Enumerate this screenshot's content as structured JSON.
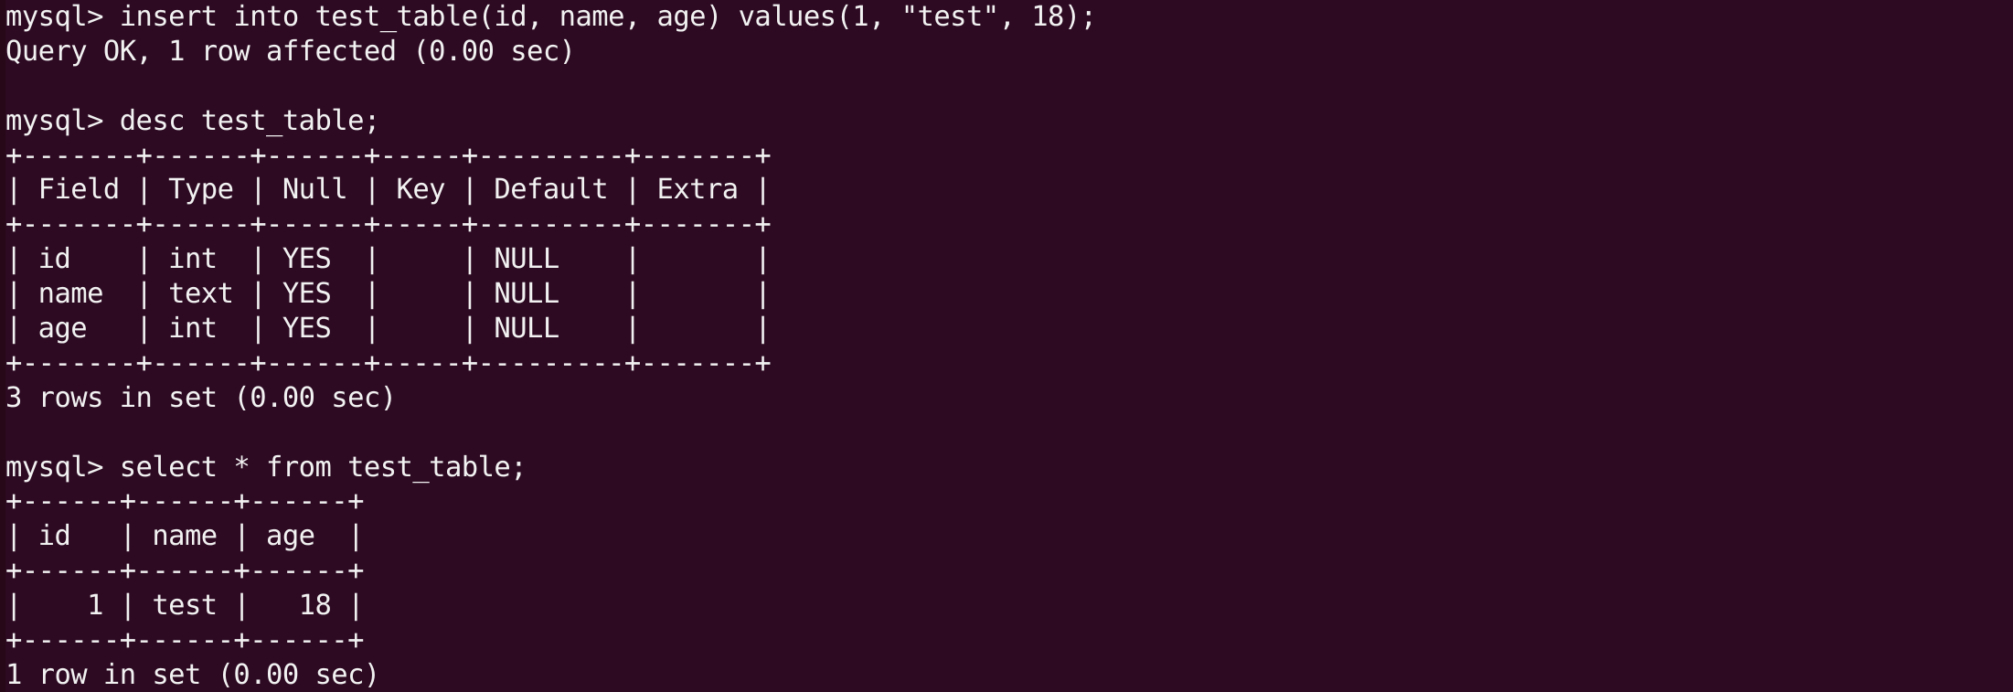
{
  "terminal": {
    "app": "mysql-client-terminal",
    "background_color": "#2d0a22",
    "foreground_color": "#f2f2f2",
    "prompt": "mysql>",
    "columns": 88,
    "visible_rows": 20
  },
  "session": {
    "statements": [
      {
        "command": "insert into test_table(id, name, age) values(1, \"test\", 18);",
        "result_status": "Query OK, 1 row affected (0.00 sec)"
      },
      {
        "command": "desc test_table;",
        "result_status": "3 rows in set (0.00 sec)"
      },
      {
        "command": "select * from test_table;",
        "result_status": "1 row in set (0.00 sec)"
      }
    ]
  },
  "describe_table": {
    "separator": "+-------+------+------+-----+---------+-------+",
    "headers": [
      "Field",
      "Type",
      "Null",
      "Key",
      "Default",
      "Extra"
    ],
    "rows": [
      [
        "id",
        "int",
        "YES",
        "",
        "NULL",
        ""
      ],
      [
        "name",
        "text",
        "YES",
        "",
        "NULL",
        ""
      ],
      [
        "age",
        "int",
        "YES",
        "",
        "NULL",
        ""
      ]
    ],
    "row_count_text": "3 rows in set (0.00 sec)"
  },
  "select_table": {
    "separator": "+------+------+------+",
    "headers": [
      "id",
      "name",
      "age"
    ],
    "rows": [
      [
        "1",
        "test",
        "18"
      ]
    ],
    "row_count_text": "1 row in set (0.00 sec)"
  },
  "lines": [
    "mysql> insert into test_table(id, name, age) values(1, \"test\", 18);",
    "Query OK, 1 row affected (0.00 sec)",
    "",
    "mysql> desc test_table;",
    "+-------+------+------+-----+---------+-------+",
    "| Field | Type | Null | Key | Default | Extra |",
    "+-------+------+------+-----+---------+-------+",
    "| id    | int  | YES  |     | NULL    |       |",
    "| name  | text | YES  |     | NULL    |       |",
    "| age   | int  | YES  |     | NULL    |       |",
    "+-------+------+------+-----+---------+-------+",
    "3 rows in set (0.00 sec)",
    "",
    "mysql> select * from test_table;",
    "+------+------+------+",
    "| id   | name | age  |",
    "+------+------+------+",
    "|    1 | test |   18 |",
    "+------+------+------+",
    "1 row in set (0.00 sec)"
  ]
}
